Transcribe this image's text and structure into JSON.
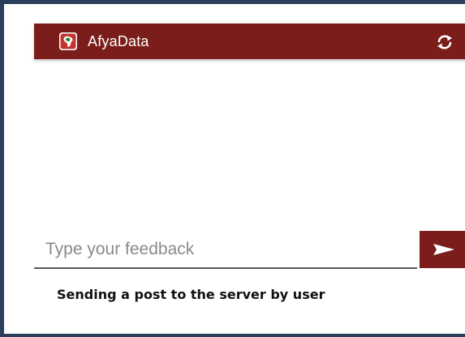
{
  "app": {
    "title": "AfyaData",
    "logo_icon": "africa-map-icon",
    "sync_icon": "sync-icon",
    "brand_color": "#7b1e1b"
  },
  "feedback": {
    "placeholder": "Type your feedback",
    "value": "",
    "send_icon": "send-icon"
  },
  "caption": "Sending a post to the server by user"
}
